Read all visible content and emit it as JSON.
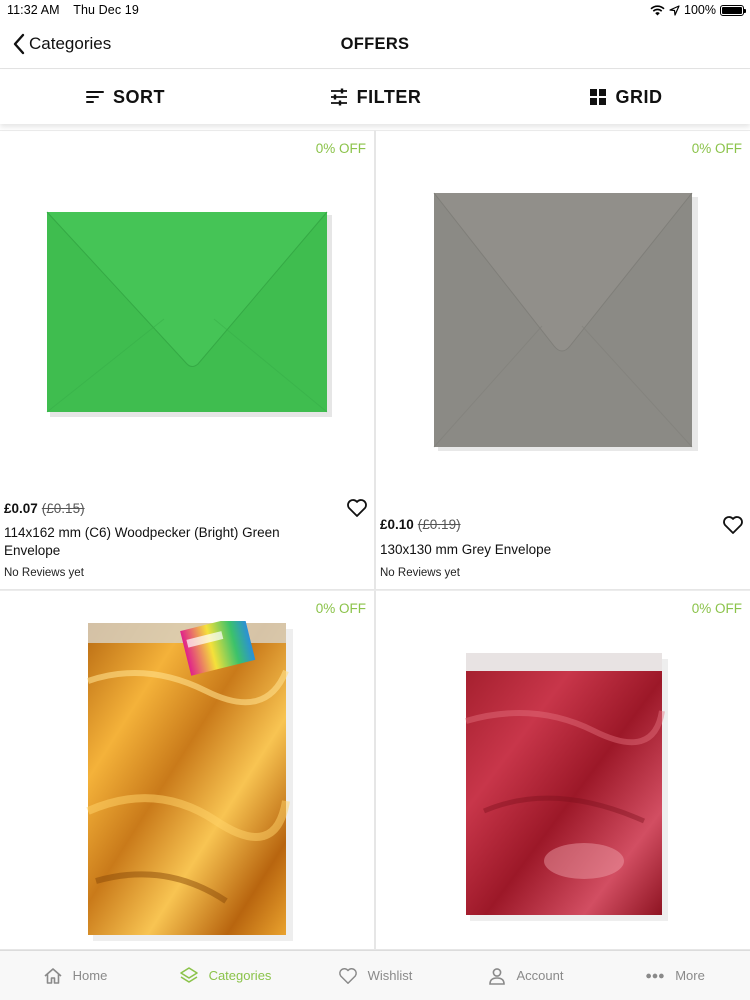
{
  "status_bar": {
    "time": "11:32 AM",
    "date": "Thu Dec 19",
    "battery": "100%",
    "icons": [
      "wifi-icon",
      "location-icon",
      "battery-icon"
    ]
  },
  "nav": {
    "back_label": "Categories",
    "title": "OFFERS"
  },
  "toolbar": {
    "sort_label": "SORT",
    "filter_label": "FILTER",
    "grid_label": "GRID"
  },
  "colors": {
    "accent": "#8bc34a",
    "text": "#111111",
    "divider": "#e6e6e6"
  },
  "products": [
    {
      "badge": "0% OFF",
      "price": "£0.07",
      "old_price": "(£0.15)",
      "name": "114x162 mm (C6) Woodpecker (Bright) Green Envelope",
      "reviews": "No Reviews yet",
      "image": "green-envelope"
    },
    {
      "badge": "0% OFF",
      "price": "£0.10",
      "old_price": "(£0.19)",
      "name": "130x130 mm Grey Envelope",
      "reviews": "No Reviews yet",
      "image": "grey-envelope"
    },
    {
      "badge": "0% OFF",
      "image": "gold-foil-bag"
    },
    {
      "badge": "0% OFF",
      "image": "red-foil-bag"
    }
  ],
  "tabs": [
    {
      "label": "Home",
      "icon": "home-icon"
    },
    {
      "label": "Categories",
      "icon": "layers-icon",
      "active": true
    },
    {
      "label": "Wishlist",
      "icon": "heart-icon"
    },
    {
      "label": "Account",
      "icon": "person-icon"
    },
    {
      "label": "More",
      "icon": "more-icon"
    }
  ]
}
